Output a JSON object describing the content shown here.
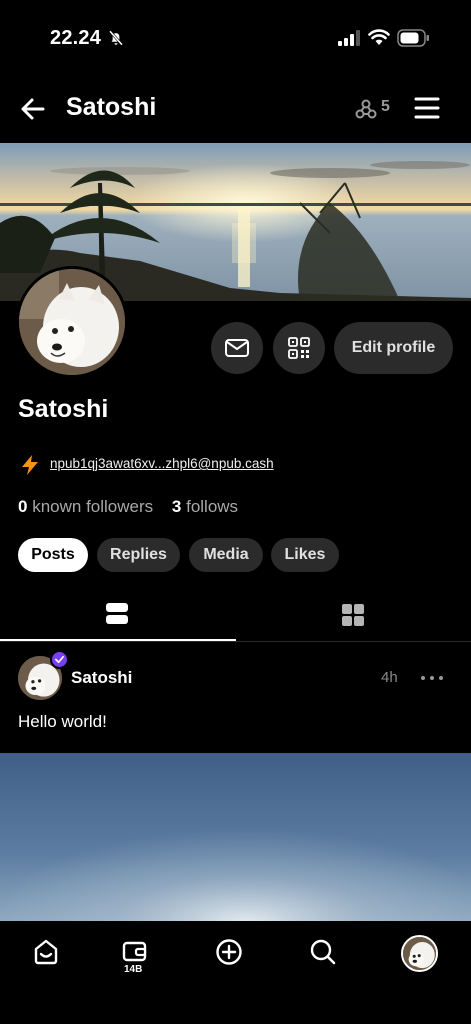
{
  "status_bar": {
    "time": "22.24",
    "icons": [
      "bell-off-icon",
      "signal-icon",
      "wifi-icon",
      "battery-icon"
    ]
  },
  "header": {
    "back_icon": "arrow-left-icon",
    "title": "Satoshi",
    "relay_icon": "relay-icon",
    "relay_count": "5",
    "menu_icon": "hamburger-menu-icon"
  },
  "profile": {
    "name": "Satoshi",
    "lightning_address": "npub1qj3awat6xv...zhpl6@npub.cash",
    "followers_count": "0",
    "followers_label": "known followers",
    "follows_count": "3",
    "follows_label": "follows",
    "actions": {
      "message_icon": "mail-icon",
      "qr_icon": "qr-code-icon",
      "edit_label": "Edit profile"
    }
  },
  "filters": [
    {
      "label": "Posts",
      "active": true
    },
    {
      "label": "Replies",
      "active": false
    },
    {
      "label": "Media",
      "active": false
    },
    {
      "label": "Likes",
      "active": false
    }
  ],
  "view_tabs": {
    "list_icon": "list-view-icon",
    "grid_icon": "grid-view-icon",
    "active": "list"
  },
  "post": {
    "author": "Satoshi",
    "time": "4h",
    "text": "Hello world!",
    "verified": true
  },
  "bottom_nav": {
    "items": [
      "home-icon",
      "wallet-icon",
      "plus-circle-icon",
      "search-icon",
      "profile-avatar"
    ],
    "wallet_badge": "14B"
  },
  "colors": {
    "background": "#000000",
    "button_bg": "#2b2b2b",
    "zap": "#f7931a",
    "verified": "#7b3ff2"
  }
}
